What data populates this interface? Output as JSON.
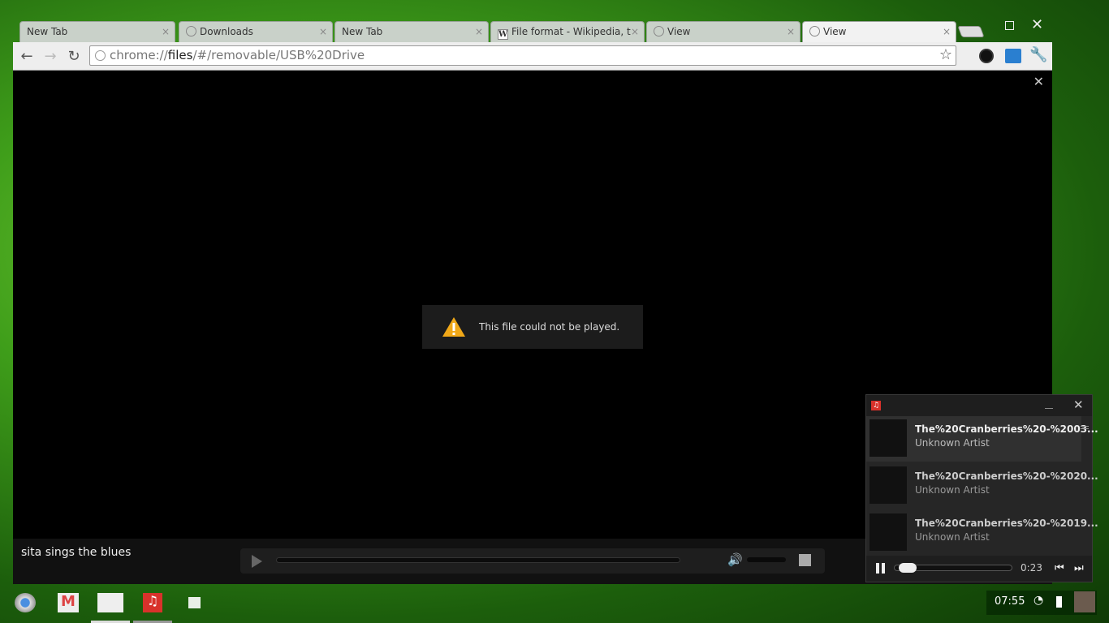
{
  "browser": {
    "tabs": [
      {
        "label": "New Tab",
        "icon": "none"
      },
      {
        "label": "Downloads",
        "icon": "globe-icon"
      },
      {
        "label": "New Tab",
        "icon": "none"
      },
      {
        "label": "File format - Wikipedia, th",
        "icon": "wikipedia-icon"
      },
      {
        "label": "View",
        "icon": "globe-icon"
      },
      {
        "label": "View",
        "icon": "globe-icon",
        "active": true
      }
    ],
    "url_prefix": "chrome://",
    "url_host": "files",
    "url_rest": "/#/removable/USB%20Drive",
    "wiki_glyph": "W"
  },
  "video": {
    "error": "This file could not be played.",
    "title": "sita sings the blues"
  },
  "audio_player": {
    "tracks": [
      {
        "title": "The%20Cranberries%20-%2003...",
        "artist": "Unknown Artist"
      },
      {
        "title": "The%20Cranberries%20-%2020...",
        "artist": "Unknown Artist"
      },
      {
        "title": "The%20Cranberries%20-%2019...",
        "artist": "Unknown Artist"
      }
    ],
    "time": "0:23",
    "progress": 0.06
  },
  "tray": {
    "clock": "07:55"
  }
}
